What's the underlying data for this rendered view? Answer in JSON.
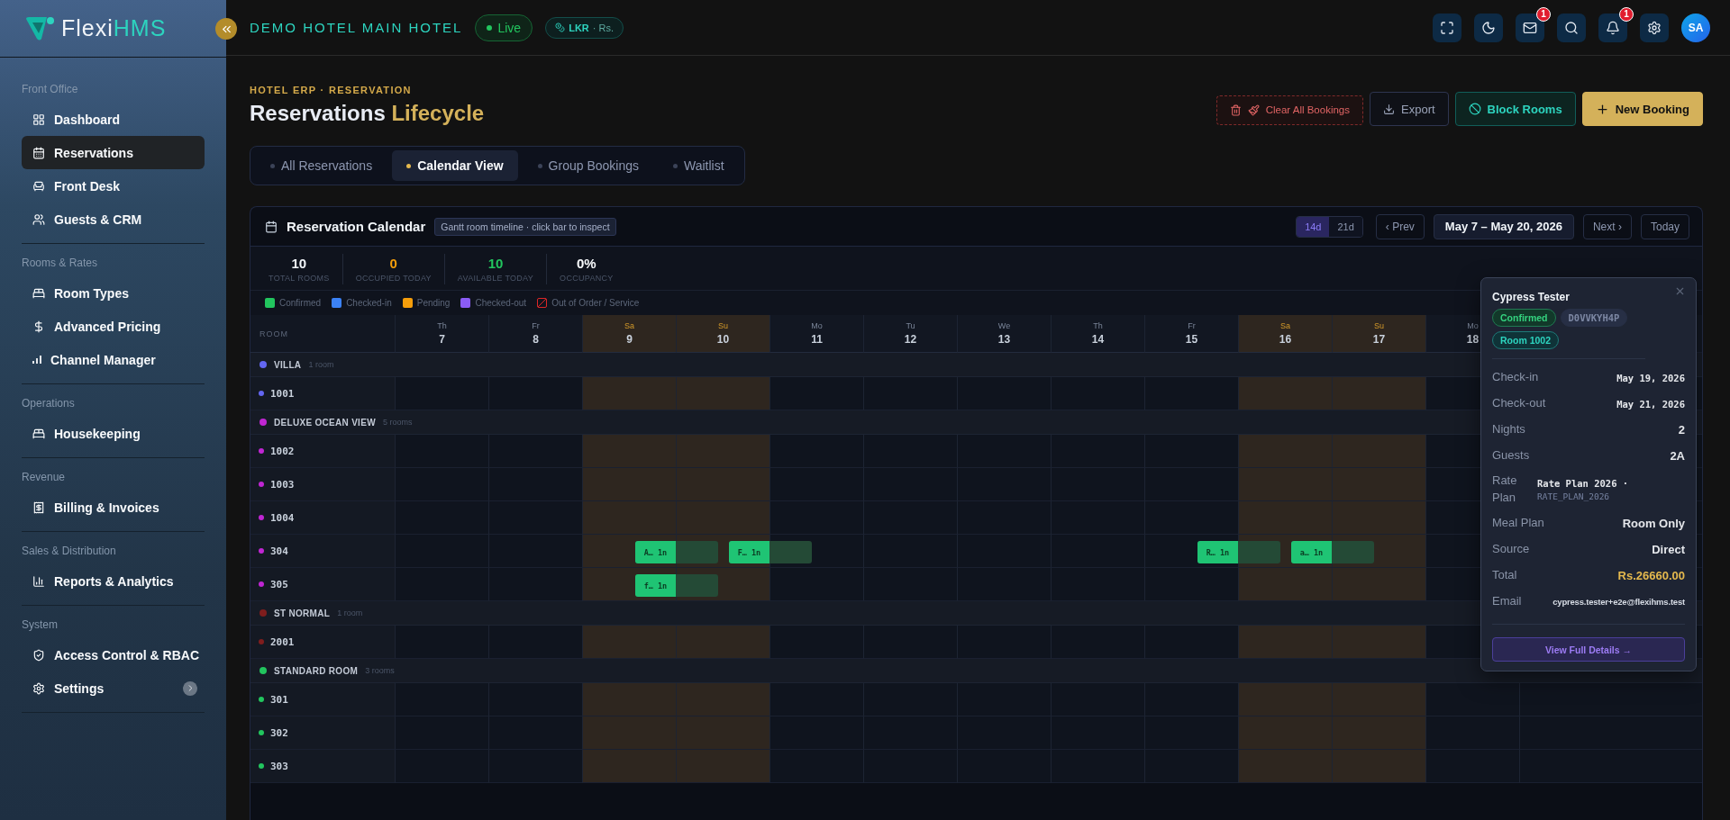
{
  "sidebar": {
    "logo": {
      "main": "Flexi",
      "accent": "HMS"
    },
    "sections": [
      {
        "title": "Front Office",
        "items": [
          {
            "label": "Dashboard",
            "selected": false
          },
          {
            "label": "Reservations",
            "selected": true
          },
          {
            "label": "Front Desk",
            "selected": false
          },
          {
            "label": "Guests & CRM",
            "selected": false
          }
        ]
      },
      {
        "title": "Rooms & Rates",
        "items": [
          {
            "label": "Room Types",
            "selected": false
          },
          {
            "label": "Advanced Pricing",
            "selected": false
          },
          {
            "label": "Channel Manager",
            "selected": false
          }
        ]
      },
      {
        "title": "Operations",
        "items": [
          {
            "label": "Housekeeping",
            "selected": false
          }
        ]
      },
      {
        "title": "Revenue",
        "items": [
          {
            "label": "Billing & Invoices",
            "selected": false
          }
        ]
      },
      {
        "title": "Sales & Distribution",
        "items": [
          {
            "label": "Reports & Analytics",
            "selected": false
          }
        ]
      },
      {
        "title": "System",
        "items": [
          {
            "label": "Access Control & RBAC",
            "selected": false
          },
          {
            "label": "Settings",
            "selected": false,
            "submenu": true
          }
        ]
      }
    ]
  },
  "header": {
    "hotel": "DEMO HOTEL MAIN HOTEL",
    "status": {
      "label": "Live",
      "live": true
    },
    "currency": {
      "code": "LKR",
      "symbol": "· Rs."
    },
    "icons": [
      {
        "kind": "fullscreen"
      },
      {
        "kind": "theme"
      },
      {
        "kind": "mail",
        "badge": "1"
      },
      {
        "kind": "search"
      },
      {
        "kind": "alerts",
        "badge": "1"
      },
      {
        "kind": "settings"
      }
    ],
    "avatar": "SA"
  },
  "page": {
    "breadcrumb": "HOTEL ERP · RESERVATION",
    "title": {
      "main": "Reservations",
      "accent": "Lifecycle"
    },
    "actions": [
      {
        "label": "Clear All Bookings",
        "kind": "danger"
      },
      {
        "label": "Export",
        "kind": "outline"
      },
      {
        "label": "Block Rooms",
        "kind": "teal"
      },
      {
        "label": "New Booking",
        "kind": "primary"
      }
    ],
    "tabs": [
      {
        "label": "All Reservations",
        "selected": false
      },
      {
        "label": "Calendar View",
        "selected": true
      },
      {
        "label": "Group Bookings",
        "selected": false
      },
      {
        "label": "Waitlist",
        "selected": false
      }
    ]
  },
  "calendar": {
    "title": "Reservation Calendar",
    "hint": "Gantt room timeline · click bar to inspect",
    "ranges": [
      {
        "label": "14d",
        "selected": true
      },
      {
        "label": "21d",
        "selected": false
      }
    ],
    "prev": "‹ Prev",
    "range": "May 7 – May 20, 2026",
    "next": "Next ›",
    "today": "Today",
    "stats": [
      {
        "value": "10",
        "label": "TOTAL ROOMS",
        "color": "#f1f5f9"
      },
      {
        "value": "0",
        "label": "OCCUPIED TODAY",
        "color": "#f59e0b"
      },
      {
        "value": "10",
        "label": "AVAILABLE TODAY",
        "color": "#22c55e"
      },
      {
        "value": "0%",
        "label": "OCCUPANCY",
        "color": "#f8fafc"
      }
    ],
    "legend": [
      {
        "label": "Confirmed",
        "kind": "solid",
        "color": "#22c55e"
      },
      {
        "label": "Checked-in",
        "kind": "solid",
        "color": "#3b82f6"
      },
      {
        "label": "Pending",
        "kind": "solid",
        "color": "#f59e0b"
      },
      {
        "label": "Checked-out",
        "kind": "solid",
        "color": "#8b5cf6"
      },
      {
        "label": "Out of Order / Service",
        "kind": "hatched",
        "color": "#dc2626"
      }
    ],
    "room_heading": "ROOM",
    "days": [
      {
        "weekday": "Th",
        "date": "7",
        "weekend": false
      },
      {
        "weekday": "Fr",
        "date": "8",
        "weekend": false
      },
      {
        "weekday": "Sa",
        "date": "9",
        "weekend": true
      },
      {
        "weekday": "Su",
        "date": "10",
        "weekend": true
      },
      {
        "weekday": "Mo",
        "date": "11",
        "weekend": false
      },
      {
        "weekday": "Tu",
        "date": "12",
        "weekend": false
      },
      {
        "weekday": "We",
        "date": "13",
        "weekend": false
      },
      {
        "weekday": "Th",
        "date": "14",
        "weekend": false
      },
      {
        "weekday": "Fr",
        "date": "15",
        "weekend": false
      },
      {
        "weekday": "Sa",
        "date": "16",
        "weekend": true
      },
      {
        "weekday": "Su",
        "date": "17",
        "weekend": true
      },
      {
        "weekday": "Mo",
        "date": "18",
        "weekend": false
      }
    ],
    "groups": [
      {
        "name": "VILLA",
        "count": "1 room",
        "color": "#6366f1",
        "rooms": [
          {
            "number": "1001"
          }
        ]
      },
      {
        "name": "DELUXE OCEAN VIEW",
        "count": "5 rooms",
        "color": "#c026d3",
        "rooms": [
          {
            "number": "1002"
          },
          {
            "number": "1003"
          },
          {
            "number": "1004"
          },
          {
            "number": "304",
            "timeline": [
              {
                "kind": "free"
              },
              {
                "kind": "free"
              },
              {
                "kind": "stay",
                "guest": "A…",
                "nights": "1n"
              },
              {
                "kind": "stay",
                "guest": "F…",
                "nights": "1n"
              },
              {
                "kind": "free"
              },
              {
                "kind": "free"
              },
              {
                "kind": "free"
              },
              {
                "kind": "free"
              },
              {
                "kind": "stay",
                "guest": "R…",
                "nights": "1n"
              },
              {
                "kind": "stay",
                "guest": "a…",
                "nights": "1n"
              }
            ]
          },
          {
            "number": "305",
            "timeline": [
              {
                "kind": "free"
              },
              {
                "kind": "free"
              },
              {
                "kind": "stay",
                "guest": "f…",
                "nights": "1n"
              }
            ]
          }
        ]
      },
      {
        "name": "ST NORMAL",
        "count": "1 room",
        "color": "#7f1d1d",
        "rooms": [
          {
            "number": "2001"
          }
        ]
      },
      {
        "name": "STANDARD ROOM",
        "count": "3 rooms",
        "color": "#22c55e",
        "rooms": [
          {
            "number": "301"
          },
          {
            "number": "302"
          },
          {
            "number": "303"
          }
        ]
      }
    ],
    "popup": {
      "guest": "Cypress Tester",
      "badges": [
        {
          "label": "Confirmed",
          "kind": "status"
        },
        {
          "label": "D0VVKYH4P",
          "kind": "code"
        },
        {
          "label": "Room 1002",
          "kind": "room"
        }
      ],
      "fields": [
        {
          "label": "Check-in",
          "value": "May 19, 2026",
          "kind": "date"
        },
        {
          "label": "Check-out",
          "value": "May 21, 2026",
          "kind": "date"
        },
        {
          "label": "Nights",
          "value": "2",
          "kind": "text"
        },
        {
          "label": "Guests",
          "value": "2A",
          "kind": "text"
        },
        {
          "label": "Rate Plan",
          "value": "Rate Plan 2026 ·",
          "code": "RATE_PLAN_2026",
          "kind": "plan"
        },
        {
          "label": "Meal Plan",
          "value": "Room Only",
          "kind": "text"
        },
        {
          "label": "Source",
          "value": "Direct",
          "kind": "text"
        },
        {
          "label": "Total",
          "value": "Rs.26660.00",
          "kind": "amount"
        },
        {
          "label": "Email",
          "value": "cypress.tester+e2e@flexihms.test",
          "kind": "email"
        }
      ],
      "button": "View Full Details →"
    }
  }
}
